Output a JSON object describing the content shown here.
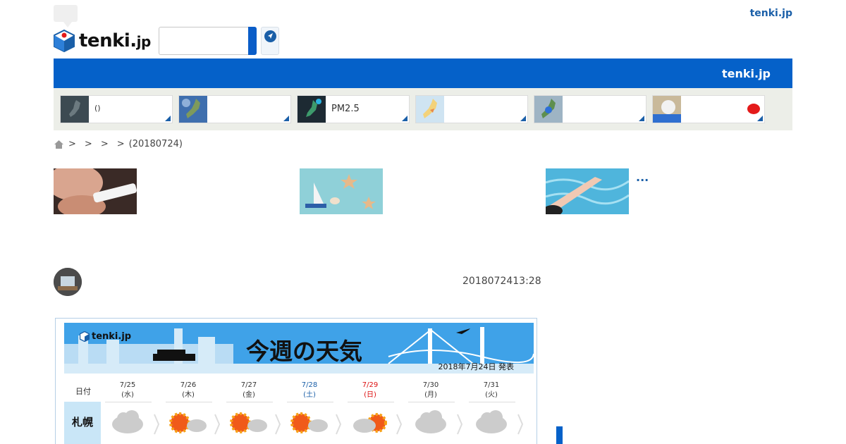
{
  "header": {
    "top_link": "tenki.jp",
    "logo_text": "tenki.",
    "logo_suffix": "jp",
    "search_placeholder": ""
  },
  "blue_bar": {
    "title": "tenki.jp"
  },
  "map_tiles": [
    {
      "label": "()"
    },
    {
      "label": ""
    },
    {
      "label": "PM2.5"
    },
    {
      "label": ""
    },
    {
      "label": ""
    },
    {
      "label": ""
    }
  ],
  "breadcrumb": {
    "separators": [
      ">",
      ">",
      ">",
      ">"
    ],
    "last": "(20180724)"
  },
  "thumbnails": {
    "more_label": "..."
  },
  "article": {
    "timestamp": "2018072413:28"
  },
  "forecast_image": {
    "logo": "tenki.jp",
    "title": "今週の天気",
    "issued": "2018年7月24日 発表",
    "date_header": "日付",
    "days": [
      {
        "date": "7/25",
        "dow": "(水)"
      },
      {
        "date": "7/26",
        "dow": "(木)"
      },
      {
        "date": "7/27",
        "dow": "(金)"
      },
      {
        "date": "7/28",
        "dow": "(土)"
      },
      {
        "date": "7/29",
        "dow": "(日)"
      },
      {
        "date": "7/30",
        "dow": "(月)"
      },
      {
        "date": "7/31",
        "dow": "(火)"
      }
    ],
    "city": "札幌",
    "weather": [
      "cloud-icon",
      "sun-cloud-icon",
      "sun-cloud-icon",
      "sun-cloud-icon",
      "cloud-sun-icon",
      "cloud-icon",
      "cloud-icon"
    ]
  },
  "colors": {
    "brand_blue": "#0561c9",
    "link_blue": "#1a5fa8",
    "saturday_blue": "#1a5fa8",
    "sunday_red": "#d11"
  }
}
